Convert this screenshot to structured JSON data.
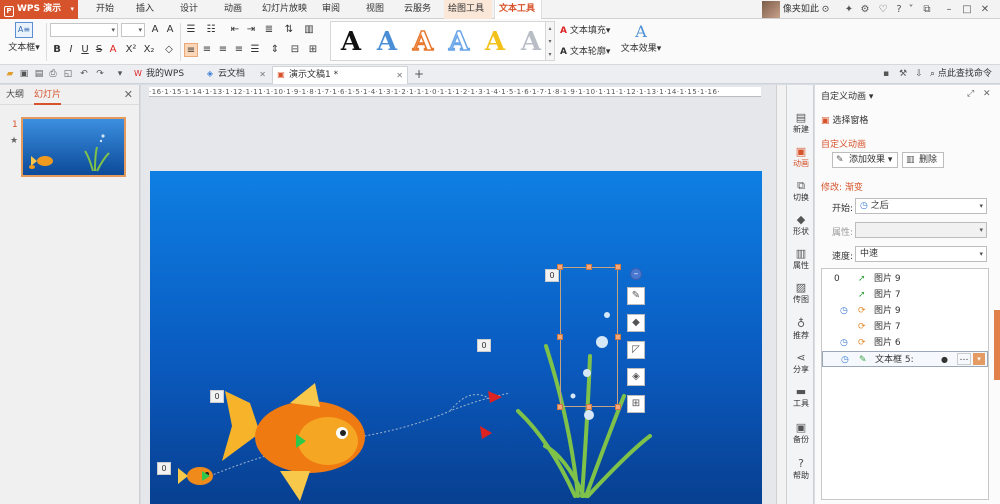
{
  "menubar": {
    "app_name": "WPS 演示",
    "items": [
      "开始",
      "插入",
      "设计",
      "动画",
      "幻灯片放映",
      "审阅",
      "视图",
      "云服务"
    ],
    "tool_tab": "绘图工具",
    "active_tab": "文本工具",
    "user_label": "像夹如此"
  },
  "ribbon": {
    "textbox_label": "文本框",
    "fill_label": "文本填充",
    "outline_label": "文本轮廓",
    "effect_label": "文本效果",
    "wordart_colors": [
      "#111111",
      "#4a8fd6",
      "#e8792f",
      "#6aa6e8",
      "#f2c21a",
      "#b9bec6"
    ]
  },
  "tabbar": {
    "tabs": [
      "我的WPS",
      "云文档",
      "演示文稿1 *"
    ],
    "search_label": "点此查找命令"
  },
  "leftpanel": {
    "tab_outline": "大纲",
    "tab_slides": "幻灯片",
    "slide_number": "1"
  },
  "ruler_text": "·16·1·15·1·14·1·13·1·12·1·11·1·10·1·9·1·8·1·7·1·6·1·5·1·4·1·3·1·2·1·1·1·0·1·1·1·2·1·3·1·4·1·5·1·6·1·7·1·8·1·9·1·10·1·11·1·12·1·13·1·14·1·15·1·16·",
  "slide": {
    "tags": [
      "0",
      "0",
      "0",
      "0"
    ]
  },
  "sidebar": {
    "items": [
      "新建",
      "动画",
      "切换",
      "形状",
      "属性",
      "传图",
      "推荐",
      "分享",
      "工具",
      "备份",
      "帮助"
    ]
  },
  "pane": {
    "title": "自定义动画",
    "select_pane": "选择窗格",
    "section_title": "自定义动画",
    "add_effect": "添加效果",
    "delete": "删除",
    "modify_label": "修改: 渐变",
    "start_label": "开始:",
    "start_value": "之后",
    "property_label": "属性:",
    "speed_label": "速度:",
    "speed_value": "中速",
    "list": [
      {
        "num": "0",
        "name": "图片 9"
      },
      {
        "num": "",
        "name": "图片 7"
      },
      {
        "num": "",
        "name": "图片 9"
      },
      {
        "num": "",
        "name": "图片 7"
      },
      {
        "num": "",
        "name": "图片 6"
      },
      {
        "num": "",
        "name": "文本框 5:"
      }
    ]
  }
}
